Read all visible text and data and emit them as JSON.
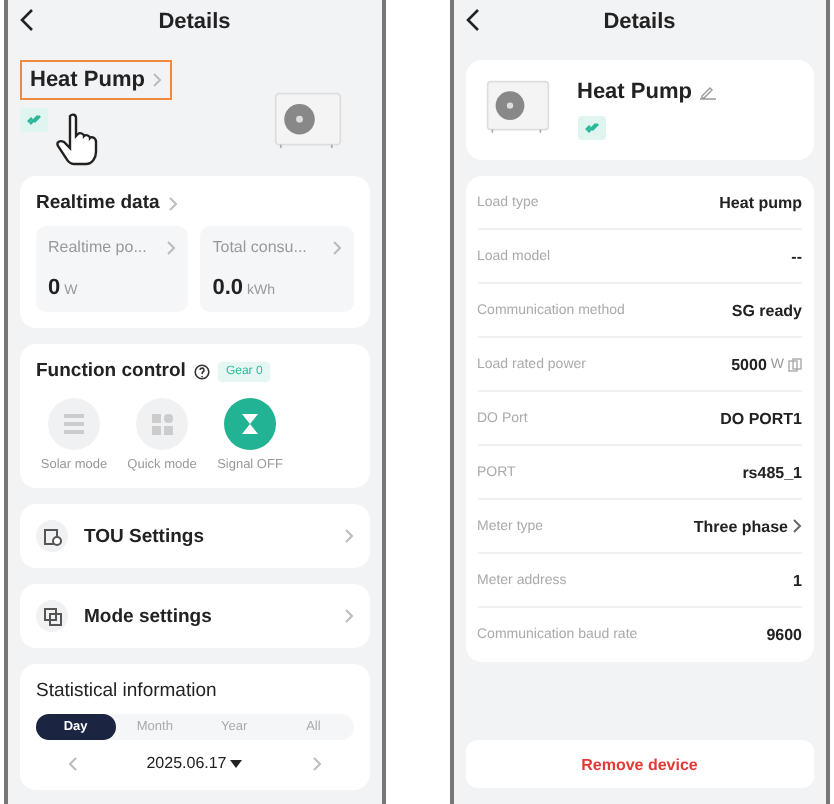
{
  "left": {
    "header": {
      "title": "Details"
    },
    "device": {
      "name": "Heat Pump",
      "highlighted": true
    },
    "realtime": {
      "title": "Realtime data",
      "tiles": [
        {
          "label": "Realtime po...",
          "value": "0",
          "unit": "W"
        },
        {
          "label": "Total consu...",
          "value": "0.0",
          "unit": "kWh"
        }
      ]
    },
    "function_control": {
      "title": "Function control",
      "badge": "Gear 0",
      "modes": [
        {
          "label": "Solar mode",
          "kind": "solar",
          "selected": false
        },
        {
          "label": "Quick mode",
          "kind": "quick",
          "selected": false
        },
        {
          "label": "Signal OFF",
          "kind": "signal",
          "selected": true
        }
      ]
    },
    "menu": [
      {
        "label": "TOU Settings",
        "kind": "calendar"
      },
      {
        "label": "Mode settings",
        "kind": "mode"
      }
    ],
    "statistics": {
      "title": "Statistical information",
      "tabs": [
        {
          "label": "Day",
          "selected": true
        },
        {
          "label": "Month",
          "selected": false
        },
        {
          "label": "Year",
          "selected": false
        },
        {
          "label": "All",
          "selected": false
        }
      ],
      "date": "2025.06.17"
    }
  },
  "right": {
    "header": {
      "title": "Details"
    },
    "device": {
      "name": "Heat Pump"
    },
    "rows": [
      {
        "label": "Load type",
        "value": "Heat pump",
        "kind": "plain"
      },
      {
        "label": "Load model",
        "value": "--",
        "kind": "plain"
      },
      {
        "label": "Communication method",
        "value": "SG ready",
        "kind": "plain"
      },
      {
        "label": "Load rated power",
        "value": "5000",
        "unit": "W",
        "kind": "copy"
      },
      {
        "label": "DO Port",
        "value": "DO PORT1",
        "kind": "plain"
      },
      {
        "label": "PORT",
        "value": "rs485_1",
        "kind": "plain"
      },
      {
        "label": "Meter type",
        "value": "Three phase",
        "kind": "link"
      },
      {
        "label": "Meter address",
        "value": "1",
        "kind": "plain"
      },
      {
        "label": "Communication baud rate",
        "value": "9600",
        "kind": "plain"
      }
    ],
    "remove_button": "Remove device"
  }
}
